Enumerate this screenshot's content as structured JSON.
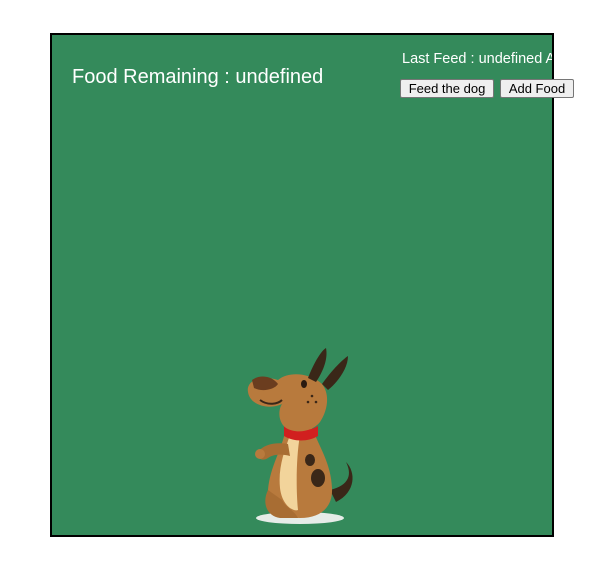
{
  "status": {
    "food_remaining": "Food Remaining : undefined",
    "last_feed": "Last Feed : undefined AM"
  },
  "controls": {
    "feed_label": "Feed the dog",
    "add_label": "Add Food"
  },
  "colors": {
    "background": "#348a5b",
    "text": "#ffffff"
  },
  "icons": {
    "dog": "dog-illustration"
  }
}
